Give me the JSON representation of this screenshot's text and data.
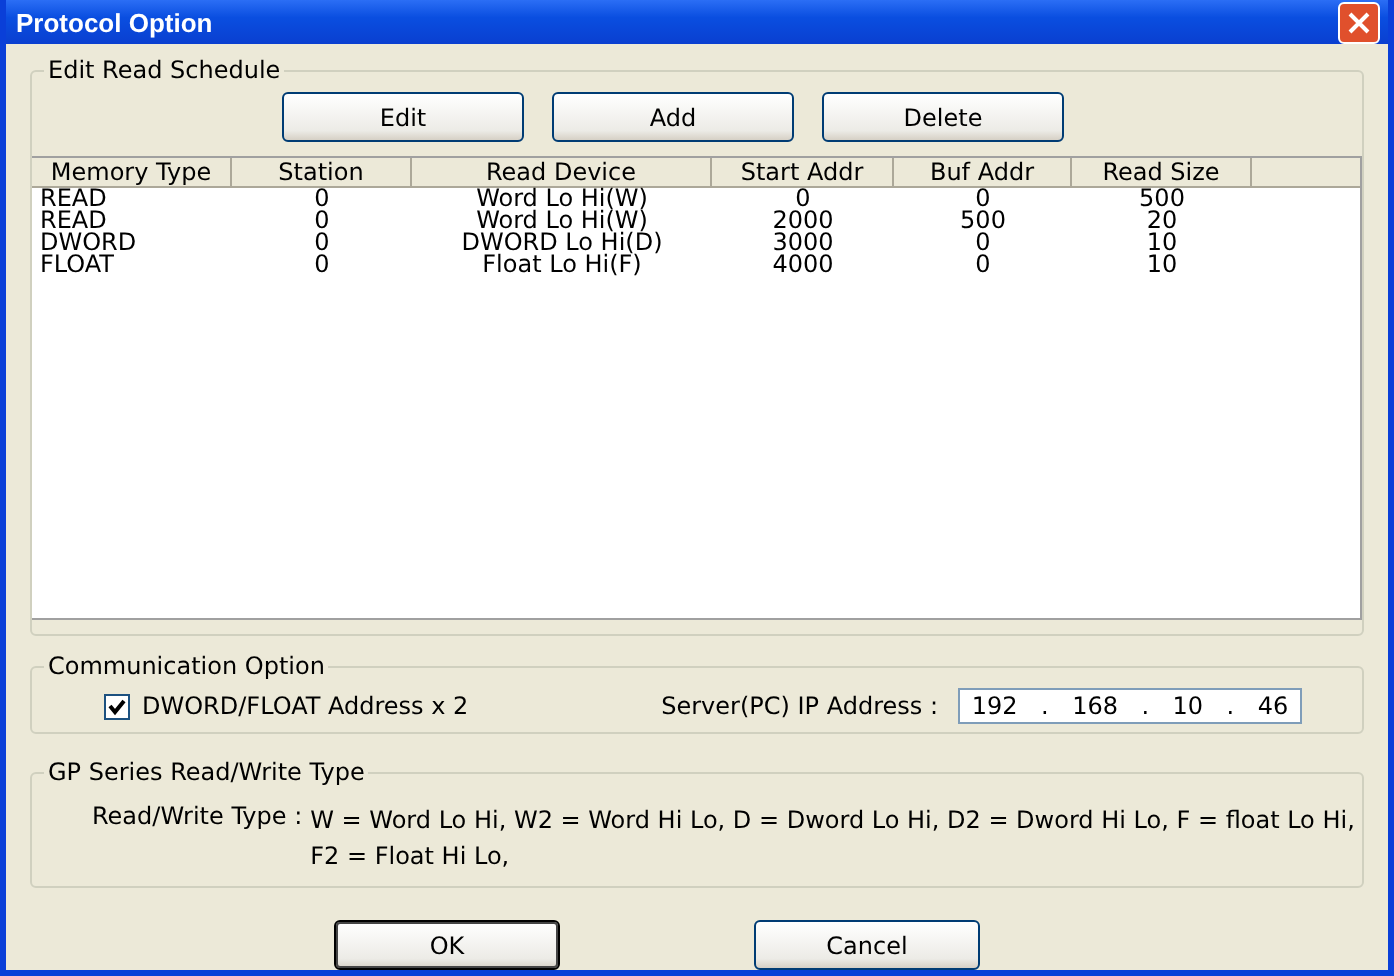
{
  "window": {
    "title": "Protocol Option"
  },
  "read_schedule": {
    "title": "Edit Read Schedule",
    "buttons": [
      "Edit",
      "Add",
      "Delete"
    ],
    "table": {
      "columns": [
        "Memory Type",
        "Station",
        "Read Device",
        "Start Addr",
        "Buf Addr",
        "Read Size"
      ],
      "rows": [
        [
          "READ",
          "0",
          "Word Lo Hi(W)",
          "0",
          "0",
          "500"
        ],
        [
          "READ",
          "0",
          "Word Lo Hi(W)",
          "2000",
          "500",
          "20"
        ],
        [
          "DWORD",
          "0",
          "DWORD Lo Hi(D)",
          "3000",
          "0",
          "10"
        ],
        [
          "FLOAT",
          "0",
          "Float Lo Hi(F)",
          "4000",
          "0",
          "10"
        ]
      ]
    }
  },
  "communication": {
    "title": "Communication Option",
    "checkbox": {
      "label": "DWORD/FLOAT Address x 2",
      "checked": true
    },
    "ip_label": "Server(PC) IP Address :",
    "ip_octets": [
      "192",
      "168",
      "10",
      "46"
    ],
    "ip_dots": [
      ".",
      ".",
      "."
    ]
  },
  "gp_series": {
    "title": "GP Series Read/Write Type",
    "label": "Read/Write Type :",
    "lines": [
      "W = Word Lo Hi, W2 = Word Hi Lo, D = Dword Lo Hi, D2 = Dword Hi Lo, F = float Lo Hi,",
      "F2 = Float Hi Lo,"
    ]
  },
  "footer_buttons": [
    {
      "label": "OK",
      "default": true
    },
    {
      "label": "Cancel",
      "default": false
    }
  ]
}
